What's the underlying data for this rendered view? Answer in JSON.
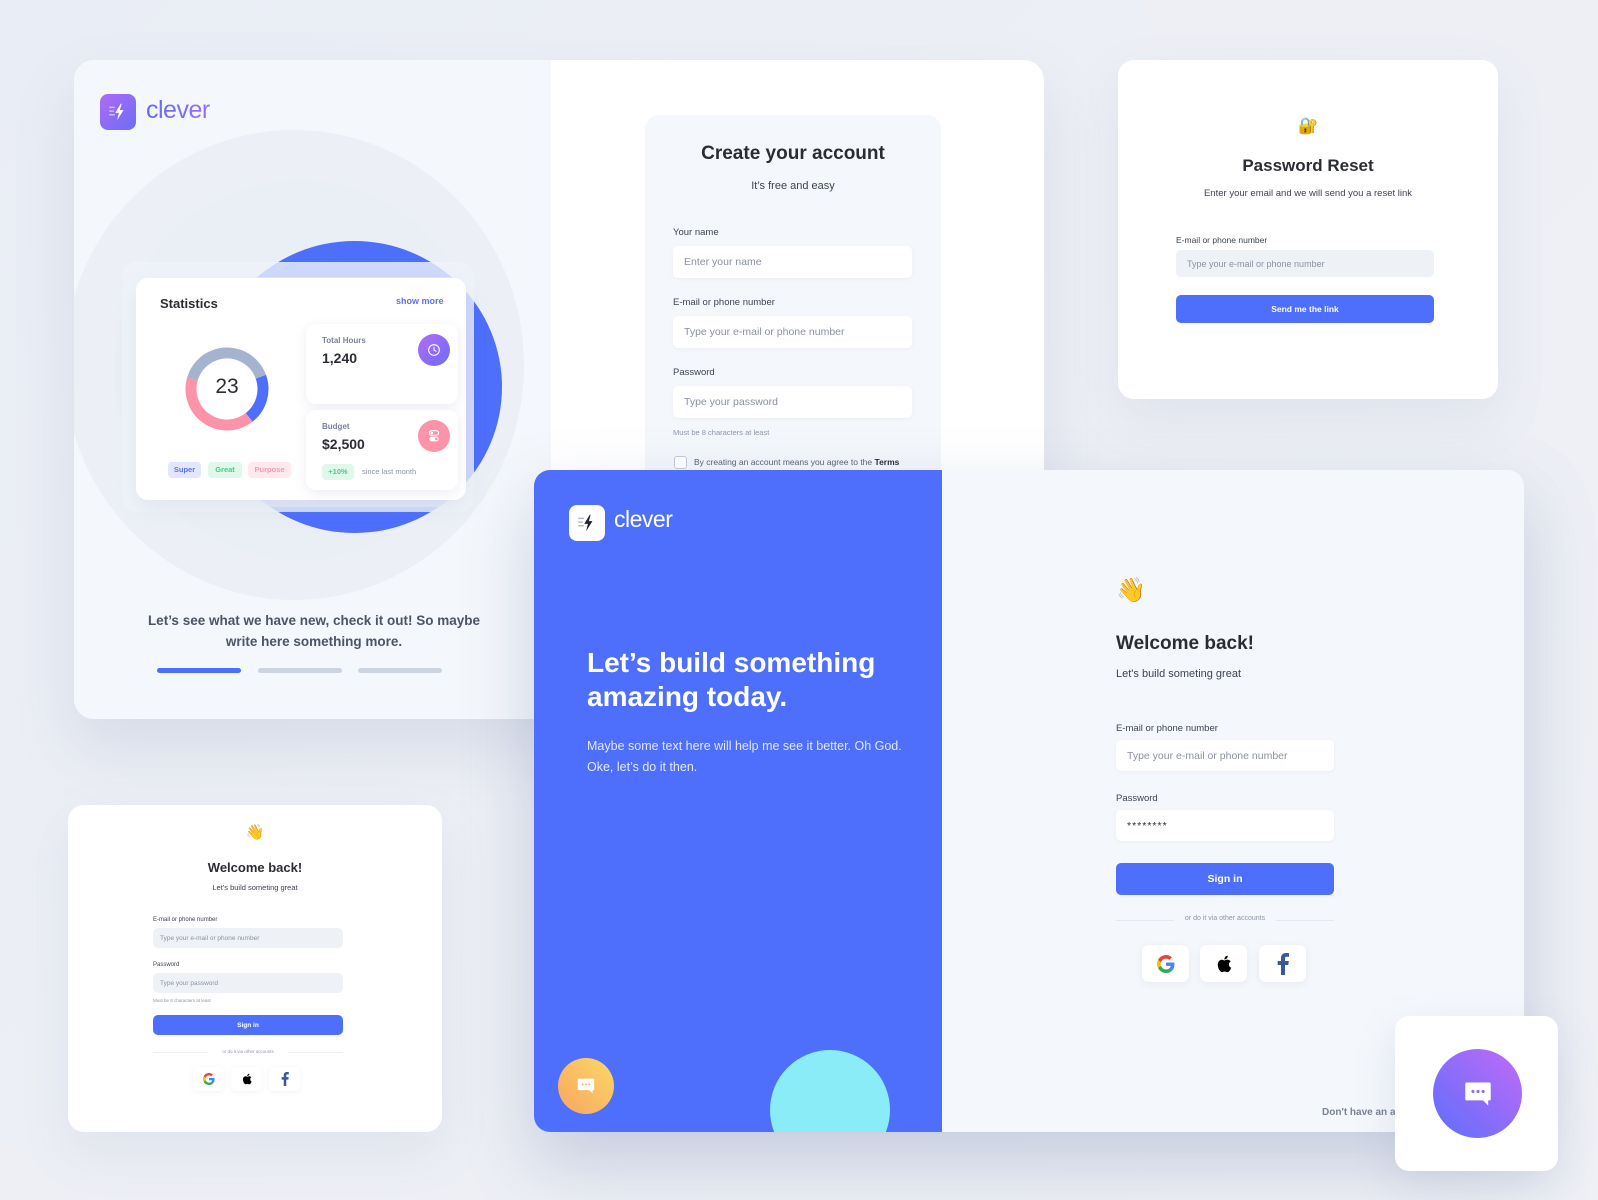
{
  "brand": {
    "name": "clever",
    "accent": "#4d6ffc",
    "gradient_start": "#b16bf5",
    "gradient_end": "#6a6cf8"
  },
  "onboarding": {
    "logo_text": "clever",
    "statistics": {
      "title": "Statistics",
      "show_more": "show more",
      "donut_value": "23",
      "donut_segments": [
        {
          "name": "Super",
          "fraction": 0.2,
          "color": "#4d6ffc"
        },
        {
          "name": "Purpose",
          "fraction": 0.4,
          "color": "#fb93a9"
        },
        {
          "name": "Great",
          "fraction": 0.4,
          "color": "#a4b4cf"
        }
      ],
      "chips": [
        "Super",
        "Great",
        "Purpose"
      ],
      "total_hours": {
        "label": "Total Hours",
        "value": "1,240",
        "icon": "clock-icon"
      },
      "budget": {
        "label": "Budget",
        "value": "$2,500",
        "change": "+10%",
        "change_note": "since last month",
        "icon": "toggle-icon"
      }
    },
    "caption": "Let’s see what we have new, check it out! So maybe write here something more.",
    "pager": {
      "count": 3,
      "active": 1
    }
  },
  "signup": {
    "title": "Create your account",
    "subtitle": "It’s free and easy",
    "fields": [
      {
        "label": "Your name",
        "placeholder": "Enter your name",
        "value": ""
      },
      {
        "label": "E-mail or phone number",
        "placeholder": "Type your e-mail or phone number",
        "value": ""
      },
      {
        "label": "Password",
        "placeholder": "Type your password",
        "value": ""
      }
    ],
    "password_hint": "Must be 8 characters at least",
    "terms_prefix": "By creating an account means you agree to the ",
    "terms_link": "Terms",
    "terms_checked": false
  },
  "reset": {
    "icon": "🔐",
    "title": "Password Reset",
    "subtitle": "Enter your email and we will send you a reset link",
    "field_label": "E-mail or phone number",
    "field_placeholder": "Type your e-mail or phone number",
    "button": "Send me the link"
  },
  "login_main": {
    "logo_text": "clever",
    "hero_title": "Let’s build something amazing today.",
    "hero_body": "Maybe some text here will help me see it better. Oh God. Oke, let’s do it then.",
    "wave": "👋",
    "title": "Welcome back!",
    "subtitle": "Let's build someting great",
    "email_label": "E-mail or phone number",
    "email_placeholder": "Type your e-mail or phone number",
    "password_label": "Password",
    "password_value": "********",
    "sign_in": "Sign in",
    "divider_text": "or do it via other accounts",
    "social": [
      "Google",
      "Apple",
      "Facebook"
    ],
    "signup_prompt": "Don't have an account?"
  },
  "login_small": {
    "wave": "👋",
    "title": "Welcome back!",
    "subtitle": "Let's build someting great",
    "email_label": "E-mail or phone number",
    "email_placeholder": "Type your e-mail or phone number",
    "password_label": "Password",
    "password_placeholder": "Type your password",
    "password_hint": "Must be 8 characters at least",
    "sign_in": "Sign in",
    "divider_text": "or do it via other accounts",
    "social": [
      "Google",
      "Apple",
      "Facebook"
    ]
  },
  "chat_widget": {
    "icon": "chat-bubble-icon"
  }
}
